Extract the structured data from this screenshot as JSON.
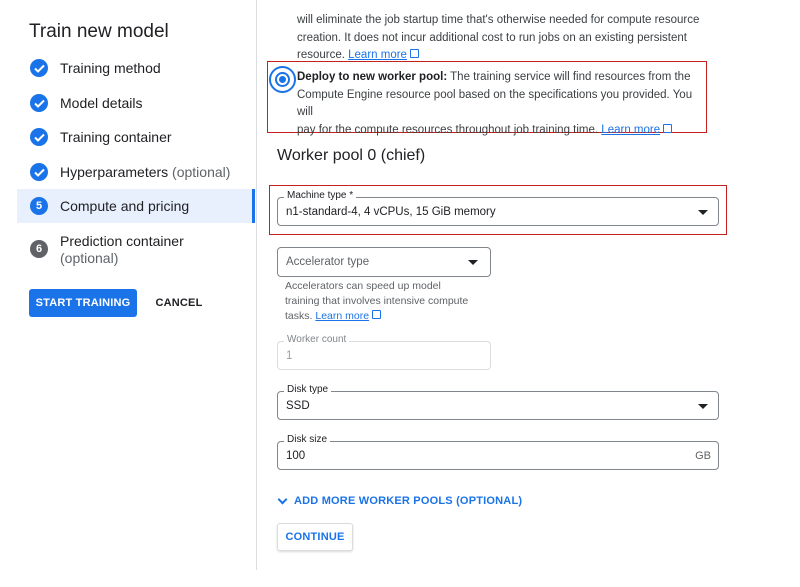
{
  "title": "Train new model",
  "steps": [
    {
      "label": "Training method",
      "status": "done"
    },
    {
      "label": "Model details",
      "status": "done"
    },
    {
      "label": "Training container",
      "status": "done"
    },
    {
      "label": "Hyperparameters",
      "optional": "(optional)",
      "status": "done"
    },
    {
      "label": "Compute and pricing",
      "number": "5",
      "status": "current"
    },
    {
      "label": "Prediction container",
      "optional": "(optional)",
      "number": "6",
      "status": "pending"
    }
  ],
  "actions": {
    "start_training": "START TRAINING",
    "cancel": "CANCEL"
  },
  "persistent": {
    "line1": "will eliminate the job startup time that's otherwise needed for compute resource",
    "line2": "creation. It does not incur additional cost to run jobs on an existing persistent",
    "line3": "resource.",
    "learn_more": "Learn more"
  },
  "deploy_option": {
    "bold": "Deploy to new worker pool:",
    "line1": " The training service will find resources from the",
    "line2": "Compute Engine resource pool based on the specifications you provided. You will",
    "line3": "pay for the compute resources throughout job training time.",
    "learn_more": "Learn more",
    "selected": true
  },
  "worker_pool_title": "Worker pool 0 (chief)",
  "machine_type": {
    "label": "Machine type *",
    "value": "n1-standard-4, 4 vCPUs, 15 GiB memory"
  },
  "accelerator": {
    "placeholder": "Accelerator type",
    "help_line1": "Accelerators can speed up model",
    "help_line2": "training that involves intensive compute",
    "help_line3": "tasks.",
    "learn_more": "Learn more"
  },
  "worker_count": {
    "label": "Worker count",
    "value": "1"
  },
  "disk_type": {
    "label": "Disk type",
    "value": "SSD"
  },
  "disk_size": {
    "label": "Disk size",
    "value": "100",
    "unit": "GB"
  },
  "add_more_pools": "ADD MORE WORKER POOLS (OPTIONAL)",
  "continue": "CONTINUE",
  "colors": {
    "accent": "#1a73e8",
    "highlight_box": "#c5221f",
    "active_step_bg": "#e8f0fe"
  }
}
